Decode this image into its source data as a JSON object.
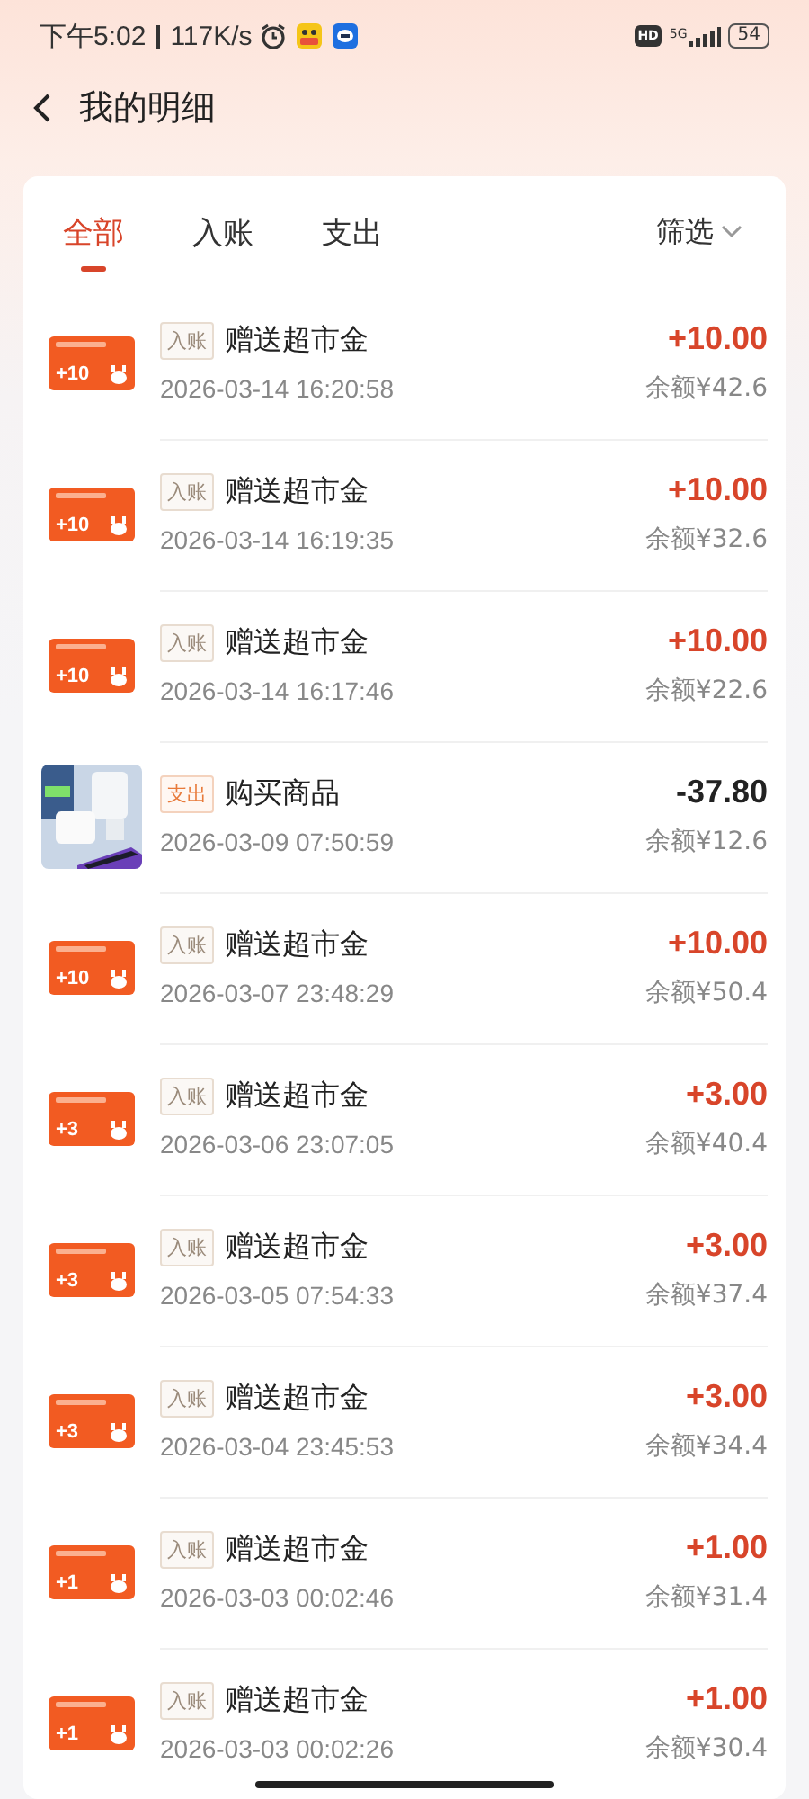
{
  "status_bar": {
    "time": "下午5:02",
    "speed": "117K/s",
    "hd": "HD",
    "network": "5G",
    "battery": "54"
  },
  "header": {
    "title": "我的明细"
  },
  "tabs": [
    {
      "label": "全部",
      "selected": true
    },
    {
      "label": "入账",
      "selected": false
    },
    {
      "label": "支出",
      "selected": false
    }
  ],
  "filter": {
    "label": "筛选"
  },
  "records": [
    {
      "kind": "bonus",
      "badge": "+10",
      "tag": "入账",
      "title": "赠送超市金",
      "time": "2026-03-14 16:20:58",
      "amount": "+10.00",
      "balance": "余额¥42.6"
    },
    {
      "kind": "bonus",
      "badge": "+10",
      "tag": "入账",
      "title": "赠送超市金",
      "time": "2026-03-14 16:19:35",
      "amount": "+10.00",
      "balance": "余额¥32.6"
    },
    {
      "kind": "bonus",
      "badge": "+10",
      "tag": "入账",
      "title": "赠送超市金",
      "time": "2026-03-14 16:17:46",
      "amount": "+10.00",
      "balance": "余额¥22.6"
    },
    {
      "kind": "purchase",
      "tag": "支出",
      "title": "购买商品",
      "time": "2026-03-09 07:50:59",
      "amount": "-37.80",
      "balance": "余额¥12.6"
    },
    {
      "kind": "bonus",
      "badge": "+10",
      "tag": "入账",
      "title": "赠送超市金",
      "time": "2026-03-07 23:48:29",
      "amount": "+10.00",
      "balance": "余额¥50.4"
    },
    {
      "kind": "bonus",
      "badge": "+3",
      "tag": "入账",
      "title": "赠送超市金",
      "time": "2026-03-06 23:07:05",
      "amount": "+3.00",
      "balance": "余额¥40.4"
    },
    {
      "kind": "bonus",
      "badge": "+3",
      "tag": "入账",
      "title": "赠送超市金",
      "time": "2026-03-05 07:54:33",
      "amount": "+3.00",
      "balance": "余额¥37.4"
    },
    {
      "kind": "bonus",
      "badge": "+3",
      "tag": "入账",
      "title": "赠送超市金",
      "time": "2026-03-04 23:45:53",
      "amount": "+3.00",
      "balance": "余额¥34.4"
    },
    {
      "kind": "bonus",
      "badge": "+1",
      "tag": "入账",
      "title": "赠送超市金",
      "time": "2026-03-03 00:02:46",
      "amount": "+1.00",
      "balance": "余额¥31.4"
    },
    {
      "kind": "bonus",
      "badge": "+1",
      "tag": "入账",
      "title": "赠送超市金",
      "time": "2026-03-03 00:02:26",
      "amount": "+1.00",
      "balance": "余额¥30.4"
    }
  ]
}
